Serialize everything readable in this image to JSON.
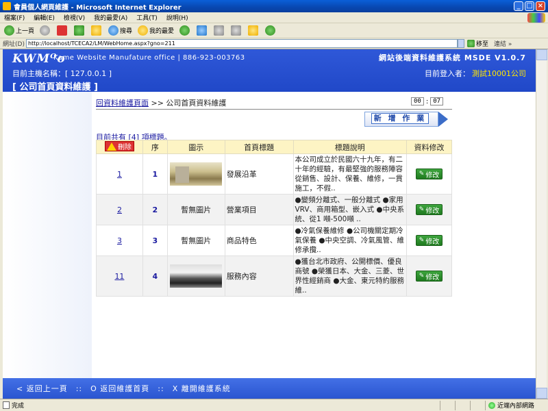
{
  "window": {
    "title": "會員個人網頁維護 - Microsoft Internet Explorer",
    "min": "_",
    "max": "□",
    "close": "×"
  },
  "menu": [
    "檔案(F)",
    "編輯(E)",
    "檢視(V)",
    "我的最愛(A)",
    "工具(T)",
    "說明(H)"
  ],
  "toolbar": {
    "back": "上一頁",
    "search": "搜尋",
    "favorites": "我的最愛"
  },
  "address": {
    "label": "網址(D)",
    "url": "http://localhost/TCECA2/LM/WebHome.aspx?gno=211",
    "go": "移至",
    "links": "連結 »"
  },
  "header": {
    "logo": "KWMᴼo",
    "company": "Kame Website Manufature office | 886-923-003763",
    "system_title": "網站後端資料維護系統 MSDE V1.0.7",
    "host": "目前主機名稱：[ 127.0.0.1 ]",
    "login_label": "目前登入者：",
    "login_user": "測試10001公司",
    "heading": "[ 公司首頁資料維護 ]"
  },
  "breadcrumb": {
    "link": "回資料維護頁面",
    "rest": " >> 公司首頁資料維護"
  },
  "timer": {
    "minutes": "00",
    "sep": ":",
    "seconds": "07"
  },
  "add_button": "新 增 作 業",
  "count_text": "目前共有 [4] 項標題。",
  "table": {
    "headers": {
      "delete": "刪除",
      "seq": "序",
      "image": "圖示",
      "title": "首頁標題",
      "desc": "標題說明",
      "edit": "資料修改"
    },
    "edit_label": "修改",
    "rows": [
      {
        "id": "1",
        "seq": "1",
        "image": "",
        "title": "發展沿革",
        "desc": "本公司成立於民國六十九年，有二十年的經驗，有最堅強的服務陣容從銷售、設計、保養、維修，一貫施工，不假.."
      },
      {
        "id": "2",
        "seq": "2",
        "image": "暫無圖片",
        "title": "營業項目",
        "desc": "●變頻分離式、一般分離式 ●家用VRV、商用箱型、嵌入式 ●中央系統、從1 噸-500噸 .."
      },
      {
        "id": "3",
        "seq": "3",
        "image": "暫無圖片",
        "title": "商品特色",
        "desc": "●冷氣保養維修 ●公司機關定期冷氣保養 ●中央空調、冷氣風管、維修承攬.."
      },
      {
        "id": "11",
        "seq": "4",
        "image": "",
        "title": "服務內容",
        "desc": "●獲台北市政府、公開標價、優良商號 ●榮獲日本、大金、三菱、世界性經銷商 ●大金、東元特約服務維.."
      }
    ]
  },
  "footer": {
    "back": "< 返回上一頁",
    "home": "O 返回維護首頁",
    "exit": "X 離開維護系統",
    "sep": "::"
  },
  "status": {
    "left": "完成",
    "zone": "近端內部網路"
  }
}
